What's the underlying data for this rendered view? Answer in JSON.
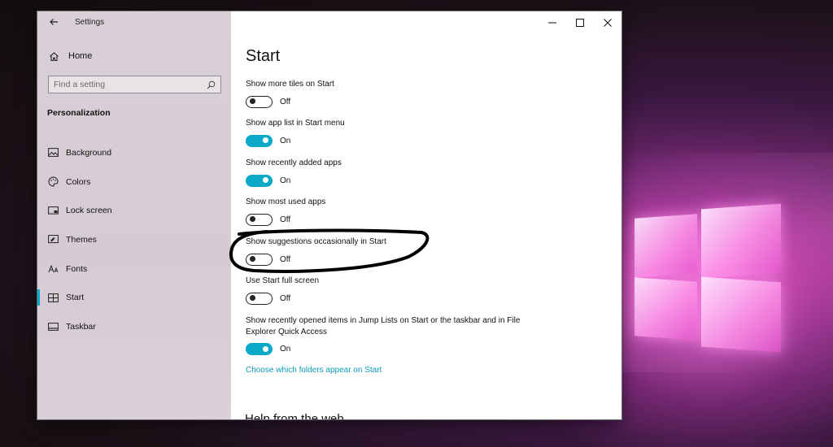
{
  "window": {
    "app_title": "Settings",
    "controls": {
      "minimize": "minimize",
      "maximize": "maximize",
      "close": "close"
    }
  },
  "sidebar": {
    "home_label": "Home",
    "search_placeholder": "Find a setting",
    "section_title": "Personalization",
    "items": [
      {
        "label": "Background",
        "icon": "picture-icon",
        "active": false
      },
      {
        "label": "Colors",
        "icon": "palette-icon",
        "active": false
      },
      {
        "label": "Lock screen",
        "icon": "lock-screen-icon",
        "active": false
      },
      {
        "label": "Themes",
        "icon": "brush-icon",
        "active": false
      },
      {
        "label": "Fonts",
        "icon": "font-icon",
        "active": false
      },
      {
        "label": "Start",
        "icon": "start-icon",
        "active": true
      },
      {
        "label": "Taskbar",
        "icon": "taskbar-icon",
        "active": false
      }
    ]
  },
  "main": {
    "title": "Start",
    "settings": [
      {
        "label": "Show more tiles on Start",
        "state": "Off",
        "on": false
      },
      {
        "label": "Show app list in Start menu",
        "state": "On",
        "on": true
      },
      {
        "label": "Show recently added apps",
        "state": "On",
        "on": true
      },
      {
        "label": "Show most used apps",
        "state": "Off",
        "on": false
      },
      {
        "label": "Show suggestions occasionally in Start",
        "state": "Off",
        "on": false
      },
      {
        "label": "Use Start full screen",
        "state": "Off",
        "on": false
      },
      {
        "label": "Show recently opened items in Jump Lists on Start or the taskbar and in File Explorer Quick Access",
        "state": "On",
        "on": true
      }
    ],
    "link": "Choose which folders appear on Start",
    "help_heading": "Help from the web"
  },
  "colors": {
    "accent": "#0aa9c8",
    "link": "#0a9bb8",
    "sidebar_bg": "#d9cfd6"
  }
}
